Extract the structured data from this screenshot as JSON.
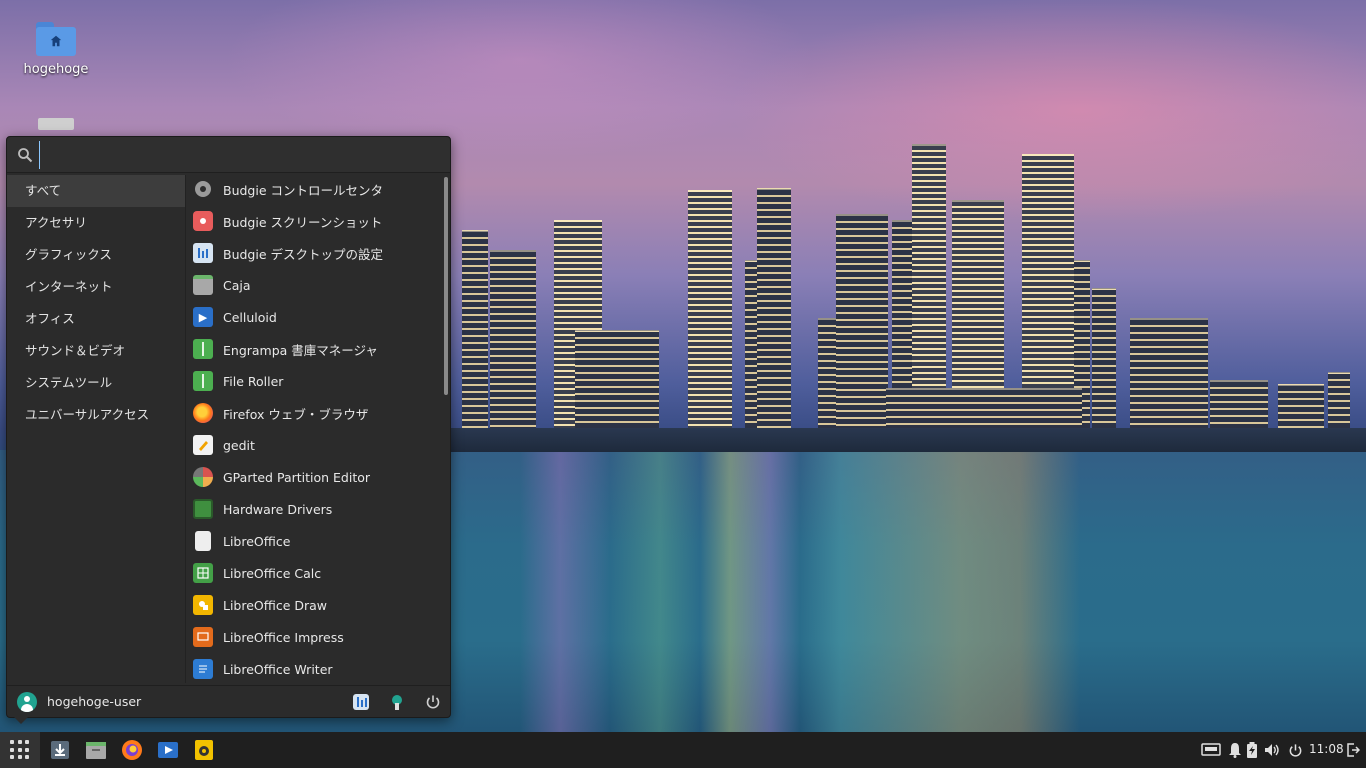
{
  "desktop": {
    "icons": [
      {
        "label": "hogehoge",
        "icon": "home-folder-icon"
      },
      {
        "label": "",
        "icon": "drive-icon"
      }
    ]
  },
  "search": {
    "value": "",
    "placeholder": ""
  },
  "categories": [
    {
      "label": "すべて",
      "active": true
    },
    {
      "label": "アクセサリ"
    },
    {
      "label": "グラフィックス"
    },
    {
      "label": "インターネット"
    },
    {
      "label": "オフィス"
    },
    {
      "label": "サウンド＆ビデオ"
    },
    {
      "label": "システムツール"
    },
    {
      "label": "ユニバーサルアクセス"
    }
  ],
  "apps": [
    {
      "label": "Budgie コントロールセンタ",
      "icon": "gear-icon",
      "color": "#9a9a9a"
    },
    {
      "label": "Budgie スクリーンショット",
      "icon": "camera-icon",
      "color": "#e85c5c"
    },
    {
      "label": "Budgie デスクトップの設定",
      "icon": "desktop-settings-icon",
      "color": "#d6e4f2"
    },
    {
      "label": "Caja",
      "icon": "file-manager-icon",
      "color": "#a8a8a8"
    },
    {
      "label": "Celluloid",
      "icon": "video-player-icon",
      "color": "#2a6fc8"
    },
    {
      "label": "Engrampa 書庫マネージャ",
      "icon": "archive-icon",
      "color": "#4caf50"
    },
    {
      "label": "File Roller",
      "icon": "archive-icon",
      "color": "#4caf50"
    },
    {
      "label": "Firefox ウェブ・ブラウザ",
      "icon": "firefox-icon",
      "color": "#ff7a1a"
    },
    {
      "label": "gedit",
      "icon": "text-editor-icon",
      "color": "#f2f2f2"
    },
    {
      "label": "GParted Partition Editor",
      "icon": "gparted-icon",
      "color": "#6aa84f"
    },
    {
      "label": "Hardware Drivers",
      "icon": "chip-icon",
      "color": "#3f8f3f"
    },
    {
      "label": "LibreOffice",
      "icon": "document-icon",
      "color": "#eeeeee"
    },
    {
      "label": "LibreOffice Calc",
      "icon": "spreadsheet-icon",
      "color": "#43a047"
    },
    {
      "label": "LibreOffice Draw",
      "icon": "draw-icon",
      "color": "#f2b600"
    },
    {
      "label": "LibreOffice Impress",
      "icon": "presentation-icon",
      "color": "#e36b1c"
    },
    {
      "label": "LibreOffice Writer",
      "icon": "writer-icon",
      "color": "#2d7cd3"
    }
  ],
  "footer": {
    "user": "hogehoge-user"
  },
  "panel": {
    "clock": "11:08",
    "tasks": [
      "download-icon",
      "file-manager-icon",
      "firefox-icon",
      "video-player-icon",
      "speaker-app-icon"
    ]
  }
}
